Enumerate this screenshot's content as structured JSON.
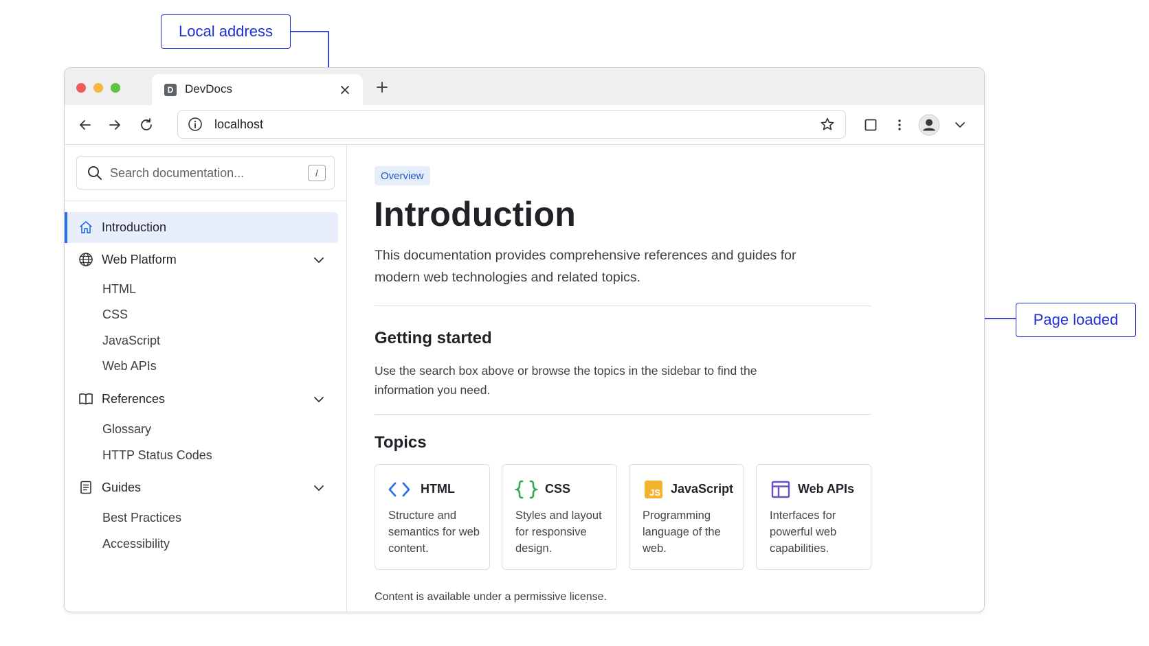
{
  "annotations": {
    "local_address": "Local address",
    "page_loaded": "Page loaded"
  },
  "browser": {
    "tab_title": "DevDocs",
    "favicon_letter": "D",
    "url": "localhost"
  },
  "sidebar": {
    "search_placeholder": "Search documentation...",
    "search_shortcut": "/",
    "active_item": "Introduction",
    "groups": [
      {
        "label": "Web Platform",
        "icon": "globe-icon",
        "items": [
          "HTML",
          "CSS",
          "JavaScript",
          "Web APIs"
        ]
      },
      {
        "label": "References",
        "icon": "book-icon",
        "items": [
          "Glossary",
          "HTTP Status Codes"
        ]
      },
      {
        "label": "Guides",
        "icon": "document-icon",
        "items": [
          "Best Practices",
          "Accessibility"
        ]
      }
    ]
  },
  "main": {
    "badge": "Overview",
    "title": "Introduction",
    "lead": "This documentation provides comprehensive references and guides for modern web technologies and related topics.",
    "getting_started": {
      "heading": "Getting started",
      "text": "Use the search box above or browse the topics in the sidebar to find the information you need."
    },
    "topics": {
      "heading": "Topics",
      "cards": [
        {
          "title": "HTML",
          "icon": "code-brackets-icon",
          "icon_color": "#2f6fe4",
          "desc": "Structure and semantics for web content."
        },
        {
          "title": "CSS",
          "icon": "curly-braces-icon",
          "icon_color": "#34a853",
          "desc": "Styles and layout for responsive design."
        },
        {
          "title": "JavaScript",
          "icon": "js-icon",
          "icon_color": "#f1b42f",
          "icon_text": "JS",
          "desc": "Programming language of the web."
        },
        {
          "title": "Web APIs",
          "icon": "layout-icon",
          "icon_color": "#6a4fc9",
          "desc": "Interfaces for powerful web capabilities."
        }
      ]
    },
    "footer": "Content is available under a permissive license."
  },
  "colors": {
    "accent": "#2f6fe4",
    "annotation": "#1f2fd6",
    "active_bg": "#e8eefc"
  }
}
